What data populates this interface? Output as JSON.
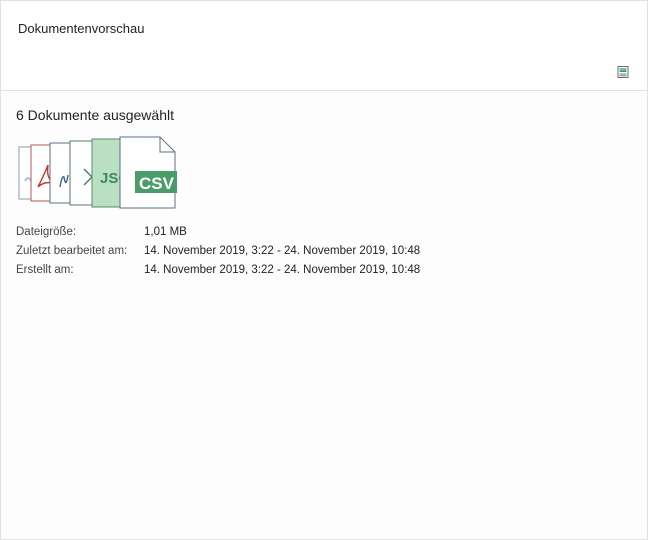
{
  "header": {
    "title": "Dokumentenvorschau"
  },
  "selection": {
    "count_text": "6 Dokumente ausgewählt"
  },
  "file_icons": {
    "json_label": "JSO",
    "csv_label": "CSV",
    "colors": {
      "csv_green": "#4a9d6a",
      "json_bg": "#b9e0c2",
      "json_text": "#3d8a57",
      "pdf_red": "#c0392b",
      "outline_blue": "#5a6f8a"
    }
  },
  "properties": [
    {
      "label": "Dateigröße:",
      "value": "1,01 MB"
    },
    {
      "label": "Zuletzt bearbeitet am:",
      "value": "14. November 2019, 3:22 - 24. November 2019, 10:48"
    },
    {
      "label": "Erstellt am:",
      "value": "14. November 2019, 3:22 - 24. November 2019, 10:48"
    }
  ]
}
